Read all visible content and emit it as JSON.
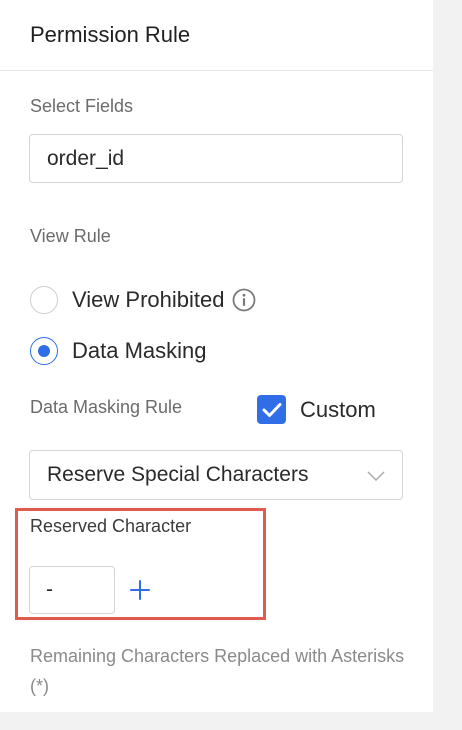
{
  "panel": {
    "title": "Permission Rule",
    "select_fields": {
      "label": "Select Fields",
      "value": "order_id"
    },
    "view_rule": {
      "label": "View Rule",
      "options": [
        {
          "label": "View Prohibited",
          "checked": false,
          "icon": "info-icon"
        },
        {
          "label": "Data Masking",
          "checked": true
        }
      ]
    },
    "masking": {
      "label": "Data Masking Rule",
      "custom_label": "Custom",
      "custom_checked": true,
      "rule_value": "Reserve Special Characters",
      "dropdown_icon": "chevron-down-icon"
    },
    "reserved": {
      "label": "Reserved Character",
      "value": "-",
      "add_icon": "plus-icon"
    },
    "description": "Remaining Characters Replaced with Asterisks (*)"
  },
  "colors": {
    "accent": "#2f6ee6",
    "highlight": "#e15a4f"
  }
}
